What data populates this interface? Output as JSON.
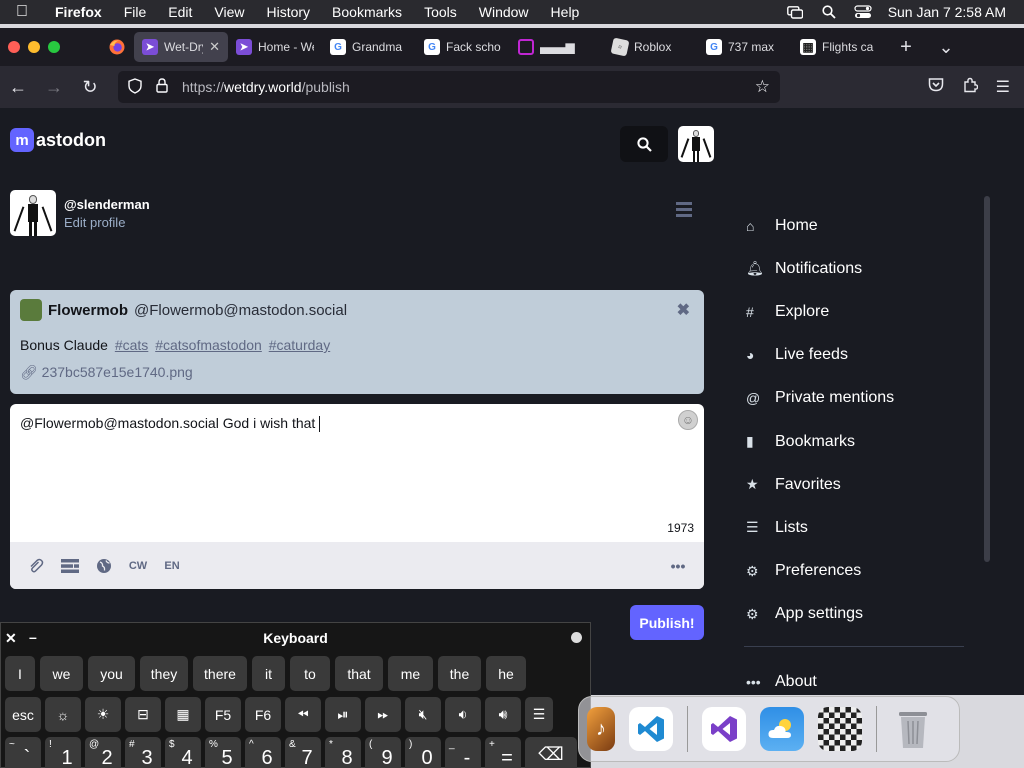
{
  "menubar": {
    "apple_icon": "apple-logo-icon",
    "items": [
      "Firefox",
      "File",
      "Edit",
      "View",
      "History",
      "Bookmarks",
      "Tools",
      "Window",
      "Help"
    ],
    "clock": "Sun Jan 7  2:58 AM",
    "status_icons": [
      "screen-mirroring-icon",
      "spotlight-search-icon",
      "control-center-icon"
    ]
  },
  "browser": {
    "tabs": [
      {
        "label": "Wet-Dry World",
        "icon": "mastodon-favicon",
        "active": true
      },
      {
        "label": "Home - Wet-Dry",
        "icon": "mastodon-favicon"
      },
      {
        "label": "Grandma",
        "icon": "google-favicon"
      },
      {
        "label": "Fack scho",
        "icon": "google-favicon"
      },
      {
        "label": "▄▄▄▆",
        "icon": "square-outline-favicon"
      },
      {
        "label": "Roblox",
        "icon": "roblox-favicon"
      },
      {
        "label": "737 max",
        "icon": "google-favicon"
      },
      {
        "label": "Flights ca",
        "icon": "grid-favicon"
      }
    ],
    "new_tab": "+",
    "tab_list": "⌄",
    "url_prefix": "https://",
    "url_host": "wetdry.world",
    "url_path": "/publish"
  },
  "mastodon": {
    "logo_text": "astodon",
    "logo_mark": "m",
    "profile": {
      "handle": "@slenderman",
      "edit_label": "Edit profile"
    },
    "reply_to": {
      "display_name": "Flowermob",
      "account": "@Flowermob@mastodon.social",
      "text": "Bonus Claude",
      "tags": [
        "#cats",
        "#catsofmastodon",
        "#caturday"
      ],
      "attachment": "237bc587e15e1740.png"
    },
    "compose": {
      "text": "@Flowermob@mastodon.social God i wish that",
      "counter": "1973",
      "cw_label": "CW",
      "lang_label": "EN"
    },
    "publish_label": "Publish!",
    "nav": [
      {
        "label": "Home",
        "icon": "home-icon"
      },
      {
        "label": "Notifications",
        "icon": "bell-icon"
      },
      {
        "label": "Explore",
        "icon": "hashtag-icon"
      },
      {
        "label": "Live feeds",
        "icon": "globe-icon"
      },
      {
        "label": "Private mentions",
        "icon": "at-sign-icon"
      },
      {
        "label": "Bookmarks",
        "icon": "bookmark-icon"
      },
      {
        "label": "Favorites",
        "icon": "star-icon"
      },
      {
        "label": "Lists",
        "icon": "list-icon"
      },
      {
        "label": "Preferences",
        "icon": "gear-icon"
      },
      {
        "label": "App settings",
        "icon": "cogs-icon"
      }
    ],
    "about": {
      "label": "About",
      "icon": "ellipsis-icon"
    }
  },
  "keyboard": {
    "title": "Keyboard",
    "suggestions": [
      "I",
      "we",
      "you",
      "they",
      "there",
      "it",
      "to",
      "that",
      "me",
      "the",
      "he"
    ],
    "function_row": [
      "esc",
      "brightness-down-icon",
      "brightness-up-icon",
      "mission-control-icon",
      "launchpad-icon",
      "F5",
      "F6",
      "rewind-icon",
      "play-pause-icon",
      "fast-forward-icon",
      "mute-icon",
      "volume-down-icon",
      "volume-up-icon",
      "list-icon"
    ],
    "number_row": [
      {
        "top": "~",
        "main": "`"
      },
      {
        "top": "!",
        "main": "1"
      },
      {
        "top": "@",
        "main": "2"
      },
      {
        "top": "#",
        "main": "3"
      },
      {
        "top": "$",
        "main": "4"
      },
      {
        "top": "%",
        "main": "5"
      },
      {
        "top": "^",
        "main": "6"
      },
      {
        "top": "&",
        "main": "7"
      },
      {
        "top": "*",
        "main": "8"
      },
      {
        "top": "(",
        "main": "9"
      },
      {
        "top": ")",
        "main": "0"
      },
      {
        "top": "_",
        "main": "-"
      },
      {
        "top": "+",
        "main": "="
      }
    ],
    "delete_icon": "delete-icon"
  },
  "dock": {
    "apps": [
      "garageband-icon",
      "vscode-icon",
      "visual-studio-icon",
      "weather-icon",
      "chess-icon",
      "trash-icon"
    ]
  },
  "colors": {
    "accent": "#6364ff",
    "page_bg": "#191b22",
    "reply_card_bg": "#c0cdd9"
  }
}
